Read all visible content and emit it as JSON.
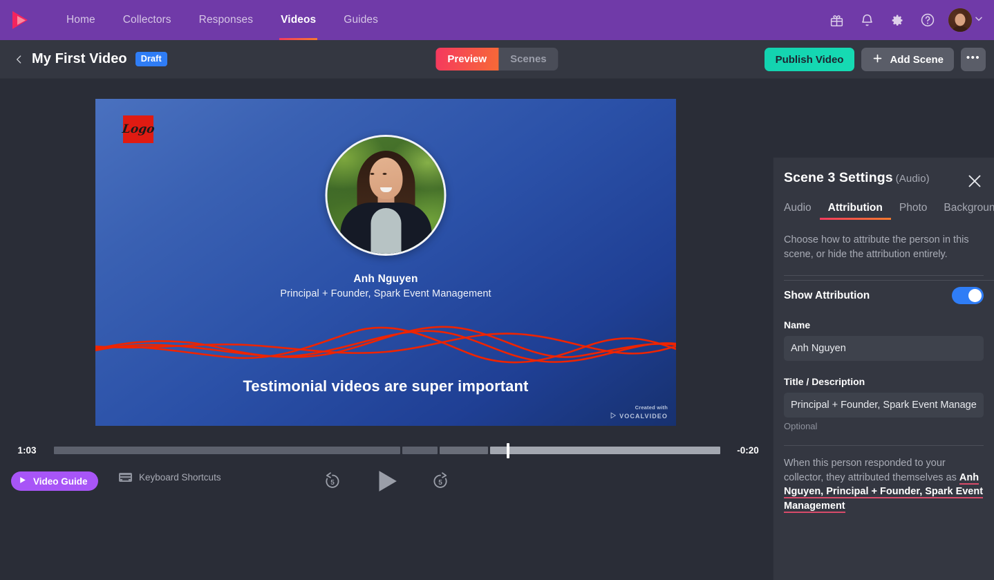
{
  "topnav": {
    "brand": "vocalvideo-play-logo",
    "items": [
      {
        "label": "Home",
        "active": false
      },
      {
        "label": "Collectors",
        "active": false
      },
      {
        "label": "Responses",
        "active": false
      },
      {
        "label": "Videos",
        "active": true
      },
      {
        "label": "Guides",
        "active": false
      }
    ],
    "icons": [
      "gift-icon",
      "bell-icon",
      "gear-icon",
      "help-circle-icon"
    ],
    "avatar_alt": "user-avatar"
  },
  "subheader": {
    "back": "back-chevron",
    "title": "My First Video",
    "badge": "Draft",
    "segments": [
      {
        "label": "Preview",
        "active": true
      },
      {
        "label": "Scenes",
        "active": false
      }
    ],
    "publish_label": "Publish Video",
    "add_scene_label": "Add Scene",
    "more_label": "•••"
  },
  "video": {
    "logo_text": "Logo",
    "name": "Anh Nguyen",
    "subtitle": "Principal + Founder, Spark Event Management",
    "caption": "Testimonial videos are super important",
    "watermark_top": "Created with",
    "watermark_brand": "VOCALVIDEO"
  },
  "player": {
    "current_time": "1:03",
    "remaining_time": "-0:20",
    "video_guide_label": "Video Guide",
    "keyboard_shortcuts_label": "Keyboard Shortcuts",
    "rewind_label": "5",
    "forward_label": "5"
  },
  "panel": {
    "title": "Scene 3 Settings",
    "title_sub": "(Audio)",
    "close": "close-icon",
    "tabs": [
      {
        "label": "Audio",
        "active": false
      },
      {
        "label": "Attribution",
        "active": true
      },
      {
        "label": "Photo",
        "active": false
      },
      {
        "label": "Background",
        "active": false
      }
    ],
    "description": "Choose how to attribute the person in this scene, or hide the attribution entirely.",
    "toggle_label": "Show Attribution",
    "toggle_on": true,
    "name_label": "Name",
    "name_value": "Anh Nguyen",
    "title_label": "Title / Description",
    "title_value": "Principal + Founder, Spark Event Management",
    "optional_hint": "Optional",
    "note_prefix": "When this person responded to your collector, they attributed themselves as ",
    "note_attribution": "Anh Nguyen, Principal + Founder, Spark Event Management"
  },
  "colors": {
    "nav_purple": "#703aa8",
    "accent_gradient_start": "#f43b5e",
    "accent_gradient_end": "#f97a2e",
    "publish_teal": "#13d2b0",
    "draft_blue": "#2f7df6",
    "toggle_blue": "#2f7df6",
    "panel_bg": "#343741",
    "app_bg": "#2a2d37",
    "video_guide_purple": "#a855f7",
    "logo_red": "#e01b12",
    "waveform_red": "#ee2400"
  }
}
